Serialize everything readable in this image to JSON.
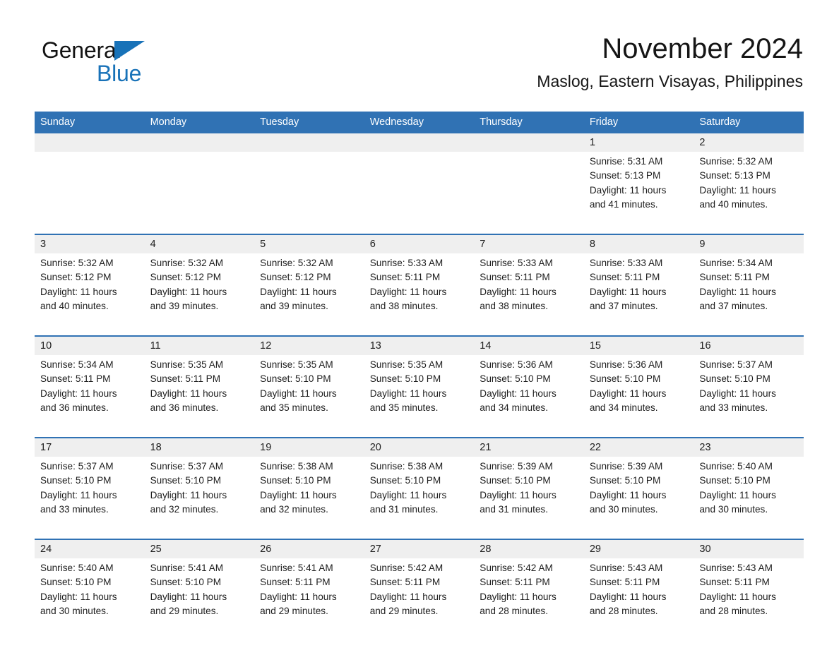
{
  "brand": {
    "name_part1": "General",
    "name_part2": "Blue",
    "accent_color": "#1872b8",
    "logo_icon": "triangle-flag-icon"
  },
  "header": {
    "month_title": "November 2024",
    "location": "Maslog, Eastern Visayas, Philippines"
  },
  "calendar": {
    "header_color": "#3072b4",
    "daynum_band_color": "#efefef",
    "weekday_headers": [
      "Sunday",
      "Monday",
      "Tuesday",
      "Wednesday",
      "Thursday",
      "Friday",
      "Saturday"
    ],
    "weeks": [
      [
        {
          "day": "",
          "sunrise": "",
          "sunset": "",
          "daylight_line1": "",
          "daylight_line2": ""
        },
        {
          "day": "",
          "sunrise": "",
          "sunset": "",
          "daylight_line1": "",
          "daylight_line2": ""
        },
        {
          "day": "",
          "sunrise": "",
          "sunset": "",
          "daylight_line1": "",
          "daylight_line2": ""
        },
        {
          "day": "",
          "sunrise": "",
          "sunset": "",
          "daylight_line1": "",
          "daylight_line2": ""
        },
        {
          "day": "",
          "sunrise": "",
          "sunset": "",
          "daylight_line1": "",
          "daylight_line2": ""
        },
        {
          "day": "1",
          "sunrise": "Sunrise: 5:31 AM",
          "sunset": "Sunset: 5:13 PM",
          "daylight_line1": "Daylight: 11 hours",
          "daylight_line2": "and 41 minutes."
        },
        {
          "day": "2",
          "sunrise": "Sunrise: 5:32 AM",
          "sunset": "Sunset: 5:13 PM",
          "daylight_line1": "Daylight: 11 hours",
          "daylight_line2": "and 40 minutes."
        }
      ],
      [
        {
          "day": "3",
          "sunrise": "Sunrise: 5:32 AM",
          "sunset": "Sunset: 5:12 PM",
          "daylight_line1": "Daylight: 11 hours",
          "daylight_line2": "and 40 minutes."
        },
        {
          "day": "4",
          "sunrise": "Sunrise: 5:32 AM",
          "sunset": "Sunset: 5:12 PM",
          "daylight_line1": "Daylight: 11 hours",
          "daylight_line2": "and 39 minutes."
        },
        {
          "day": "5",
          "sunrise": "Sunrise: 5:32 AM",
          "sunset": "Sunset: 5:12 PM",
          "daylight_line1": "Daylight: 11 hours",
          "daylight_line2": "and 39 minutes."
        },
        {
          "day": "6",
          "sunrise": "Sunrise: 5:33 AM",
          "sunset": "Sunset: 5:11 PM",
          "daylight_line1": "Daylight: 11 hours",
          "daylight_line2": "and 38 minutes."
        },
        {
          "day": "7",
          "sunrise": "Sunrise: 5:33 AM",
          "sunset": "Sunset: 5:11 PM",
          "daylight_line1": "Daylight: 11 hours",
          "daylight_line2": "and 38 minutes."
        },
        {
          "day": "8",
          "sunrise": "Sunrise: 5:33 AM",
          "sunset": "Sunset: 5:11 PM",
          "daylight_line1": "Daylight: 11 hours",
          "daylight_line2": "and 37 minutes."
        },
        {
          "day": "9",
          "sunrise": "Sunrise: 5:34 AM",
          "sunset": "Sunset: 5:11 PM",
          "daylight_line1": "Daylight: 11 hours",
          "daylight_line2": "and 37 minutes."
        }
      ],
      [
        {
          "day": "10",
          "sunrise": "Sunrise: 5:34 AM",
          "sunset": "Sunset: 5:11 PM",
          "daylight_line1": "Daylight: 11 hours",
          "daylight_line2": "and 36 minutes."
        },
        {
          "day": "11",
          "sunrise": "Sunrise: 5:35 AM",
          "sunset": "Sunset: 5:11 PM",
          "daylight_line1": "Daylight: 11 hours",
          "daylight_line2": "and 36 minutes."
        },
        {
          "day": "12",
          "sunrise": "Sunrise: 5:35 AM",
          "sunset": "Sunset: 5:10 PM",
          "daylight_line1": "Daylight: 11 hours",
          "daylight_line2": "and 35 minutes."
        },
        {
          "day": "13",
          "sunrise": "Sunrise: 5:35 AM",
          "sunset": "Sunset: 5:10 PM",
          "daylight_line1": "Daylight: 11 hours",
          "daylight_line2": "and 35 minutes."
        },
        {
          "day": "14",
          "sunrise": "Sunrise: 5:36 AM",
          "sunset": "Sunset: 5:10 PM",
          "daylight_line1": "Daylight: 11 hours",
          "daylight_line2": "and 34 minutes."
        },
        {
          "day": "15",
          "sunrise": "Sunrise: 5:36 AM",
          "sunset": "Sunset: 5:10 PM",
          "daylight_line1": "Daylight: 11 hours",
          "daylight_line2": "and 34 minutes."
        },
        {
          "day": "16",
          "sunrise": "Sunrise: 5:37 AM",
          "sunset": "Sunset: 5:10 PM",
          "daylight_line1": "Daylight: 11 hours",
          "daylight_line2": "and 33 minutes."
        }
      ],
      [
        {
          "day": "17",
          "sunrise": "Sunrise: 5:37 AM",
          "sunset": "Sunset: 5:10 PM",
          "daylight_line1": "Daylight: 11 hours",
          "daylight_line2": "and 33 minutes."
        },
        {
          "day": "18",
          "sunrise": "Sunrise: 5:37 AM",
          "sunset": "Sunset: 5:10 PM",
          "daylight_line1": "Daylight: 11 hours",
          "daylight_line2": "and 32 minutes."
        },
        {
          "day": "19",
          "sunrise": "Sunrise: 5:38 AM",
          "sunset": "Sunset: 5:10 PM",
          "daylight_line1": "Daylight: 11 hours",
          "daylight_line2": "and 32 minutes."
        },
        {
          "day": "20",
          "sunrise": "Sunrise: 5:38 AM",
          "sunset": "Sunset: 5:10 PM",
          "daylight_line1": "Daylight: 11 hours",
          "daylight_line2": "and 31 minutes."
        },
        {
          "day": "21",
          "sunrise": "Sunrise: 5:39 AM",
          "sunset": "Sunset: 5:10 PM",
          "daylight_line1": "Daylight: 11 hours",
          "daylight_line2": "and 31 minutes."
        },
        {
          "day": "22",
          "sunrise": "Sunrise: 5:39 AM",
          "sunset": "Sunset: 5:10 PM",
          "daylight_line1": "Daylight: 11 hours",
          "daylight_line2": "and 30 minutes."
        },
        {
          "day": "23",
          "sunrise": "Sunrise: 5:40 AM",
          "sunset": "Sunset: 5:10 PM",
          "daylight_line1": "Daylight: 11 hours",
          "daylight_line2": "and 30 minutes."
        }
      ],
      [
        {
          "day": "24",
          "sunrise": "Sunrise: 5:40 AM",
          "sunset": "Sunset: 5:10 PM",
          "daylight_line1": "Daylight: 11 hours",
          "daylight_line2": "and 30 minutes."
        },
        {
          "day": "25",
          "sunrise": "Sunrise: 5:41 AM",
          "sunset": "Sunset: 5:10 PM",
          "daylight_line1": "Daylight: 11 hours",
          "daylight_line2": "and 29 minutes."
        },
        {
          "day": "26",
          "sunrise": "Sunrise: 5:41 AM",
          "sunset": "Sunset: 5:11 PM",
          "daylight_line1": "Daylight: 11 hours",
          "daylight_line2": "and 29 minutes."
        },
        {
          "day": "27",
          "sunrise": "Sunrise: 5:42 AM",
          "sunset": "Sunset: 5:11 PM",
          "daylight_line1": "Daylight: 11 hours",
          "daylight_line2": "and 29 minutes."
        },
        {
          "day": "28",
          "sunrise": "Sunrise: 5:42 AM",
          "sunset": "Sunset: 5:11 PM",
          "daylight_line1": "Daylight: 11 hours",
          "daylight_line2": "and 28 minutes."
        },
        {
          "day": "29",
          "sunrise": "Sunrise: 5:43 AM",
          "sunset": "Sunset: 5:11 PM",
          "daylight_line1": "Daylight: 11 hours",
          "daylight_line2": "and 28 minutes."
        },
        {
          "day": "30",
          "sunrise": "Sunrise: 5:43 AM",
          "sunset": "Sunset: 5:11 PM",
          "daylight_line1": "Daylight: 11 hours",
          "daylight_line2": "and 28 minutes."
        }
      ]
    ]
  }
}
